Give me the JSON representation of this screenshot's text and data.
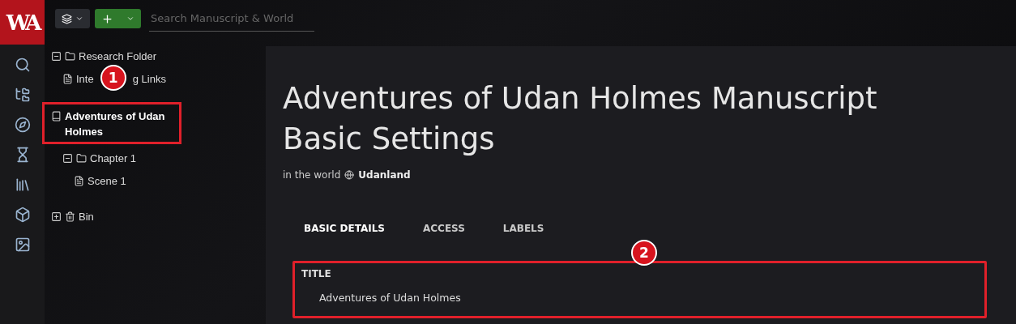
{
  "logo": "WA",
  "rail": [
    {
      "kind": "search"
    },
    {
      "kind": "tree"
    },
    {
      "kind": "compass"
    },
    {
      "kind": "hourglass"
    },
    {
      "kind": "library"
    },
    {
      "kind": "box"
    },
    {
      "kind": "image"
    }
  ],
  "toolbar": {
    "search": {
      "placeholder": "Search Manuscript & World"
    }
  },
  "tree": [
    {
      "kind": "folder",
      "label": "Research Folder",
      "expanded": true,
      "selected": false,
      "children": [
        {
          "kind": "file",
          "label_parts": [
            "Inte",
            "g Links"
          ],
          "badge": "1",
          "selected": false
        }
      ]
    },
    {
      "kind": "book",
      "label": "Adventures of Udan Holmes",
      "selected": true,
      "children": [
        {
          "kind": "folder",
          "label": "Chapter 1",
          "expanded": true,
          "selected": false,
          "children": [
            {
              "kind": "file",
              "label": "Scene 1",
              "selected": false
            }
          ]
        }
      ]
    },
    {
      "kind": "bin",
      "label": "Bin",
      "expanded": false,
      "selected": false
    }
  ],
  "page": {
    "title": "Adventures of Udan Holmes Manuscript Basic Settings",
    "world_prefix": "in the world",
    "world": "Udanland",
    "tabs": [
      {
        "label": "BASIC DETAILS",
        "selected": true
      },
      {
        "label": "ACCESS",
        "selected": false
      },
      {
        "label": "LABELS",
        "selected": false
      }
    ],
    "fields": [
      {
        "label": "TITLE",
        "value": "Adventures of Udan Holmes"
      }
    ]
  },
  "annotations": [
    {
      "number": "2"
    }
  ]
}
